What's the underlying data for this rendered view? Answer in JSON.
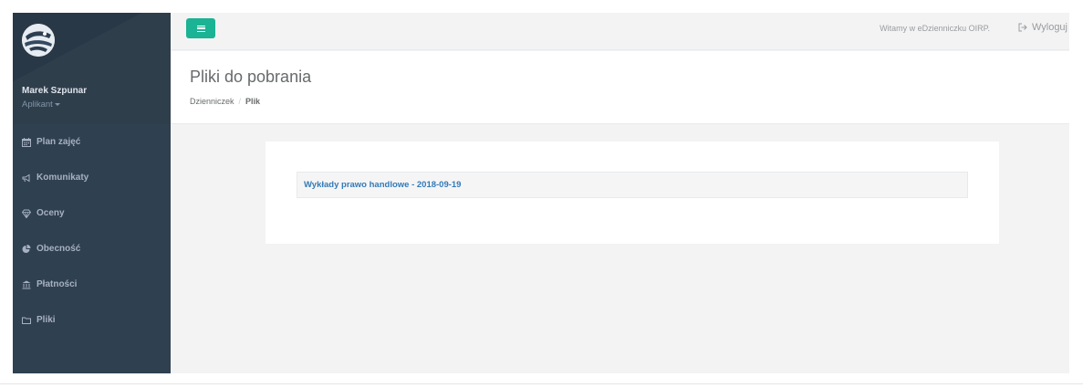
{
  "user": {
    "name": "Marek Szpunar",
    "role": "Aplikant"
  },
  "nav": {
    "items": [
      {
        "label": "Plan zajęć",
        "icon": "calendar-icon"
      },
      {
        "label": "Komunikaty",
        "icon": "bullhorn-icon"
      },
      {
        "label": "Oceny",
        "icon": "diamond-icon"
      },
      {
        "label": "Obecność",
        "icon": "pie-chart-icon"
      },
      {
        "label": "Płatności",
        "icon": "bank-icon"
      },
      {
        "label": "Pliki",
        "icon": "folder-icon"
      }
    ]
  },
  "topbar": {
    "menu_icon": "bars-icon",
    "welcome": "Witamy w eDzienniczku OIRP.",
    "logout_label": "Wyloguj",
    "logout_icon": "sign-out-icon"
  },
  "page": {
    "title": "Pliki do pobrania",
    "breadcrumb": {
      "root": "Dzienniczek",
      "separator": "/",
      "current": "Plik"
    }
  },
  "files": [
    {
      "label": "Wykłady prawo handlowe - 2018-09-19"
    }
  ],
  "colors": {
    "sidebar": "#2f4050",
    "accent": "#1ab394",
    "link": "#337ab7",
    "background": "#f3f3f4"
  }
}
